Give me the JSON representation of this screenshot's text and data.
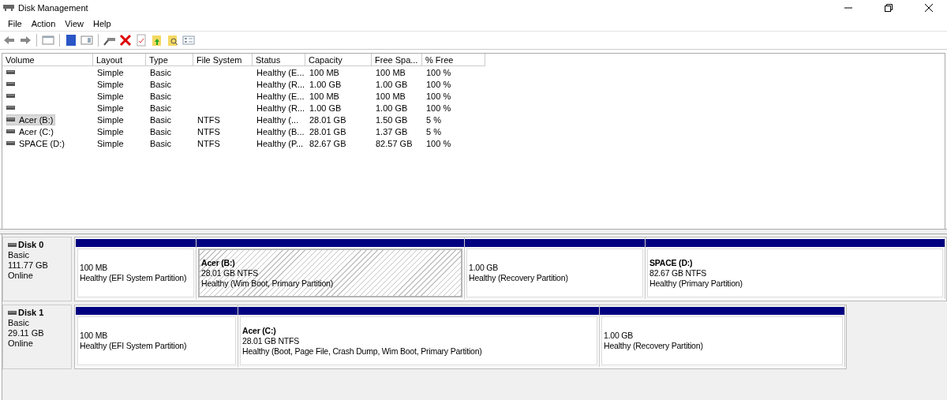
{
  "window": {
    "title": "Disk Management"
  },
  "menu": [
    "File",
    "Action",
    "View",
    "Help"
  ],
  "table": {
    "columns": [
      "Volume",
      "Layout",
      "Type",
      "File System",
      "Status",
      "Capacity",
      "Free Spa...",
      "% Free"
    ],
    "rows": [
      {
        "cells": [
          "",
          "Simple",
          "Basic",
          "",
          "Healthy (E...",
          "100 MB",
          "100 MB",
          "100 %"
        ],
        "selected": false
      },
      {
        "cells": [
          "",
          "Simple",
          "Basic",
          "",
          "Healthy (R...",
          "1.00 GB",
          "1.00 GB",
          "100 %"
        ],
        "selected": false
      },
      {
        "cells": [
          "",
          "Simple",
          "Basic",
          "",
          "Healthy (E...",
          "100 MB",
          "100 MB",
          "100 %"
        ],
        "selected": false
      },
      {
        "cells": [
          "",
          "Simple",
          "Basic",
          "",
          "Healthy (R...",
          "1.00 GB",
          "1.00 GB",
          "100 %"
        ],
        "selected": false
      },
      {
        "cells": [
          "Acer (B:)",
          "Simple",
          "Basic",
          "NTFS",
          "Healthy (...",
          "28.01 GB",
          "1.50 GB",
          "5 %"
        ],
        "selected": true
      },
      {
        "cells": [
          "Acer (C:)",
          "Simple",
          "Basic",
          "NTFS",
          "Healthy (B...",
          "28.01 GB",
          "1.37 GB",
          "5 %"
        ],
        "selected": false
      },
      {
        "cells": [
          "SPACE (D:)",
          "Simple",
          "Basic",
          "NTFS",
          "Healthy (P...",
          "82.67 GB",
          "82.57 GB",
          "100 %"
        ],
        "selected": false
      }
    ]
  },
  "disks": [
    {
      "name": "Disk 0",
      "type": "Basic",
      "size": "111.77 GB",
      "state": "Online",
      "partitions": [
        {
          "size": "100 MB",
          "status": "Healthy (EFI System Partition)",
          "selected": false
        },
        {
          "name": "Acer  (B:)",
          "size": "28.01 GB NTFS",
          "status": "Healthy (Wim Boot, Primary Partition)",
          "selected": true
        },
        {
          "size": "1.00 GB",
          "status": "Healthy (Recovery Partition)",
          "selected": false
        },
        {
          "name": "SPACE  (D:)",
          "size": "82.67 GB NTFS",
          "status": "Healthy (Primary Partition)",
          "selected": false
        }
      ]
    },
    {
      "name": "Disk 1",
      "type": "Basic",
      "size": "29.11 GB",
      "state": "Online",
      "partitions": [
        {
          "size": "100 MB",
          "status": "Healthy (EFI System Partition)",
          "selected": false
        },
        {
          "name": "Acer  (C:)",
          "size": "28.01 GB NTFS",
          "status": "Healthy (Boot, Page File, Crash Dump, Wim Boot, Primary Partition)",
          "selected": false
        },
        {
          "size": "1.00 GB",
          "status": "Healthy (Recovery Partition)",
          "selected": false
        }
      ]
    }
  ]
}
